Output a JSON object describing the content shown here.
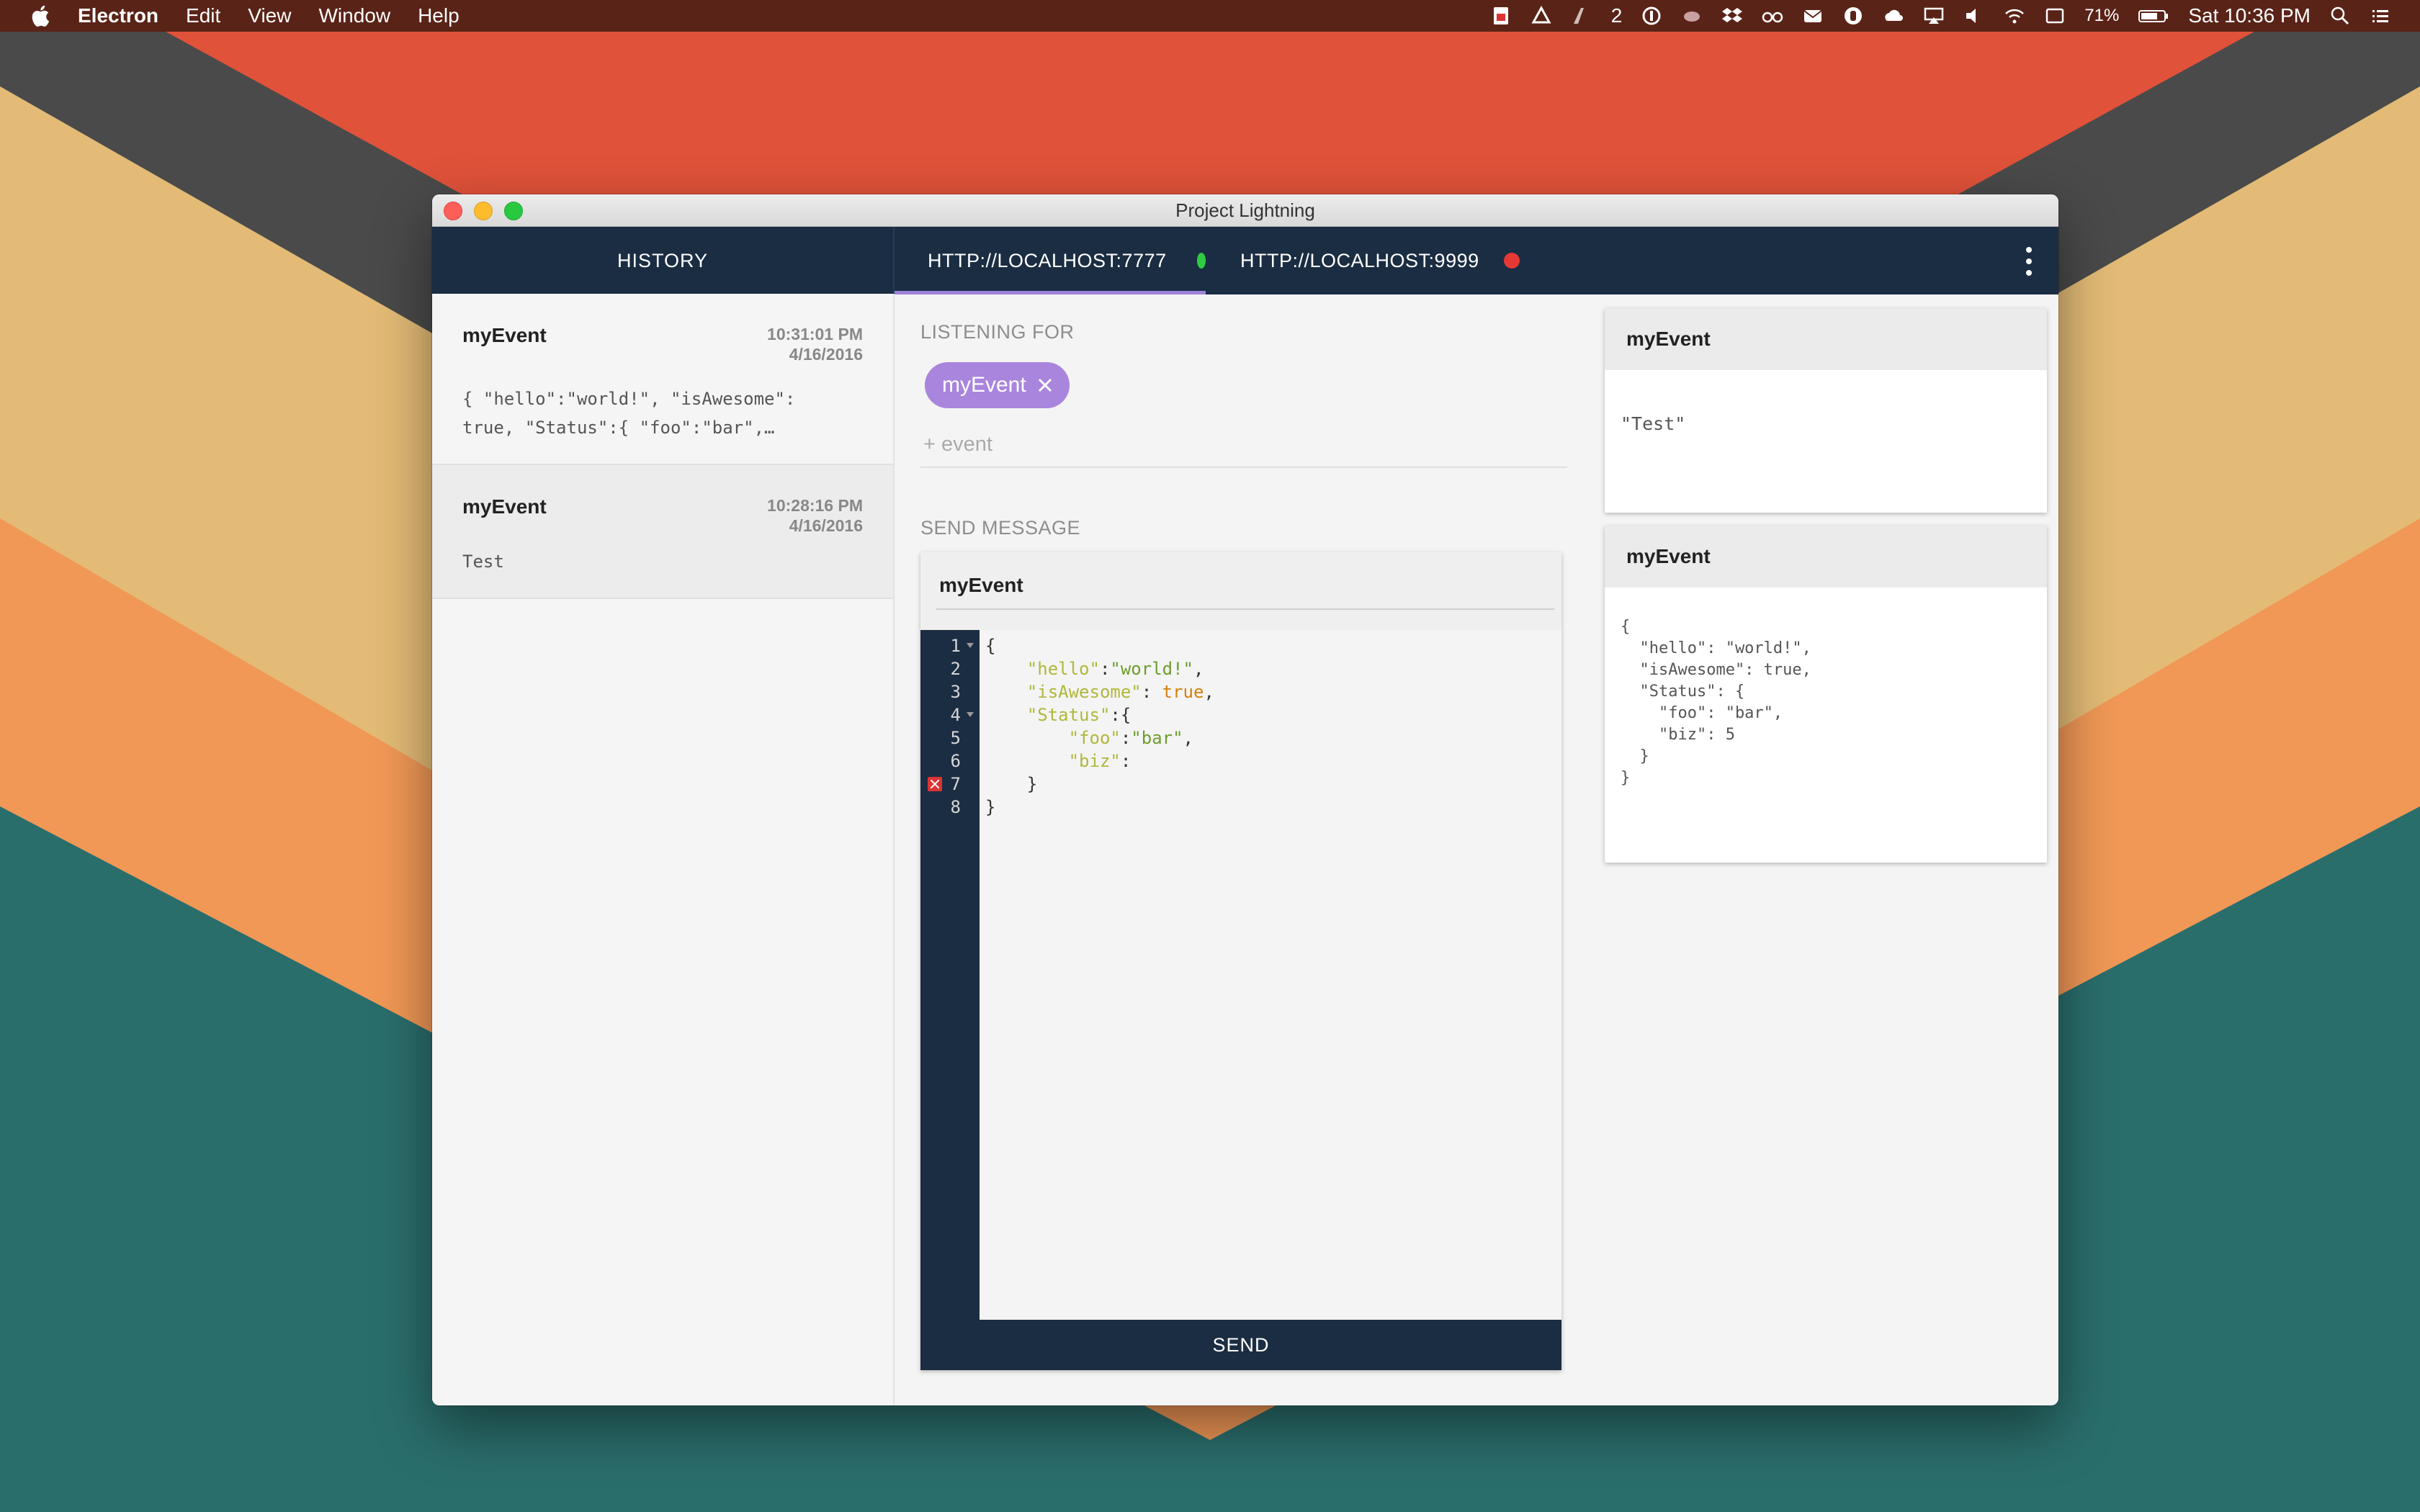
{
  "menubar": {
    "app_name": "Electron",
    "menus": [
      "Edit",
      "View",
      "Window",
      "Help"
    ],
    "tray_badge": "2",
    "battery": "71%",
    "clock": "Sat 10:36 PM",
    "icons": [
      "acrobat-icon",
      "google-drive-icon",
      "adobe-icon",
      "1password-icon",
      "cloud-icon",
      "dropbox-icon",
      "glasses-icon",
      "mail-icon",
      "dashlane-icon",
      "creative-cloud-icon",
      "airplay-icon",
      "volume-icon",
      "wifi-icon",
      "keyboard-icon",
      "battery-icon",
      "spotlight-icon",
      "notification-center-icon"
    ]
  },
  "window": {
    "title": "Project Lightning"
  },
  "appbar": {
    "history_label": "HISTORY",
    "servers": [
      {
        "url": "HTTP://LOCALHOST:7777",
        "status_color": "#2ecc40",
        "active": true
      },
      {
        "url": "HTTP://LOCALHOST:9999",
        "status_color": "#e53935",
        "active": false
      }
    ]
  },
  "history": [
    {
      "event": "myEvent",
      "time": "10:31:01 PM",
      "date": "4/16/2016",
      "preview": "{ \"hello\":\"world!\", \"isAwesome\": true, \"Status\":{ \"foo\":\"bar\",…"
    },
    {
      "event": "myEvent",
      "time": "10:28:16 PM",
      "date": "4/16/2016",
      "preview": "Test"
    }
  ],
  "listening": {
    "label": "LISTENING FOR",
    "chips": [
      "myEvent"
    ],
    "input_placeholder": "+ event"
  },
  "send": {
    "label": "SEND MESSAGE",
    "event_name": "myEvent",
    "button_label": "SEND",
    "line_numbers": [
      "1",
      "2",
      "3",
      "4",
      "5",
      "6",
      "7",
      "8"
    ]
  },
  "received": [
    {
      "event": "myEvent",
      "body": "\"Test\""
    },
    {
      "event": "myEvent",
      "body": "{\n  \"hello\": \"world!\",\n  \"isAwesome\": true,\n  \"Status\": {\n    \"foo\": \"bar\",\n    \"biz\": 5\n  }\n}"
    }
  ]
}
